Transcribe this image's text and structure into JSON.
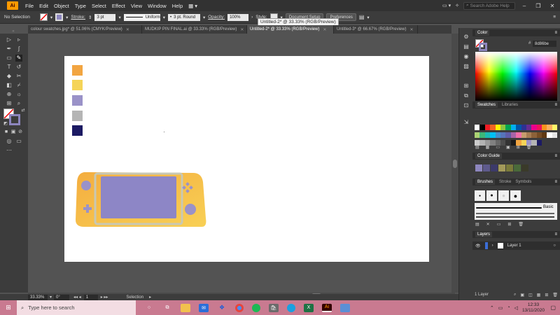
{
  "app": {
    "logo_text": "Ai"
  },
  "menu": [
    "File",
    "Edit",
    "Object",
    "Type",
    "Select",
    "Effect",
    "View",
    "Window",
    "Help"
  ],
  "search": {
    "placeholder": "Search Adobe Help"
  },
  "controlbar": {
    "selection": "No Selection",
    "stroke_label": "Stroke:",
    "stroke_value": "3 pt",
    "profile": "Uniform",
    "brush": "3 pt. Round",
    "opacity_label": "Opacity:",
    "opacity_value": "100%",
    "style_label": "Style:",
    "doc_setup": "Document Setup",
    "preferences": "Preferences"
  },
  "tooltip": "Untitled-2* @ 33.33% (RGB/Preview)",
  "tabs": [
    {
      "label": "colour swatches.jpg* @ 51.06% (CMYK/Preview)",
      "active": false
    },
    {
      "label": "MUDKIP PIN FINAL.ai @ 33.33% (RGB/Preview)",
      "active": false
    },
    {
      "label": "Untitled-2* @ 33.33% (RGB/Preview)",
      "active": true
    },
    {
      "label": "Untitled-3* @ 66.67% (RGB/Preview)",
      "active": false
    }
  ],
  "swatch_colors": [
    "#f2a541",
    "#f5d458",
    "#9a92c8",
    "#b5b5b5",
    "#1c1a63"
  ],
  "console": {
    "body": "#f4ad3f",
    "body_light": "#f8d055",
    "screen": "#8d86c6",
    "frame": "#c8c8b4",
    "buttons": "#9a92c8"
  },
  "status": {
    "zoom": "33.33%",
    "rotation": "0°",
    "artboard": "1",
    "tool": "Selection"
  },
  "panels": {
    "color": {
      "title": "Color",
      "hex": "8d86be"
    },
    "swatches": {
      "tab1": "Swatches",
      "tab2": "Libraries"
    },
    "color_guide": {
      "title": "Color Guide"
    },
    "brushes": {
      "tab1": "Brushes",
      "tab2": "Stroke",
      "tab3": "Symbols",
      "basic": "Basic"
    },
    "layers": {
      "title": "Layers",
      "layer1": "Layer 1",
      "count": "1 Layer"
    }
  },
  "taskbar": {
    "search": "Type here to search",
    "time": "12:33",
    "date": "13/11/2020"
  }
}
